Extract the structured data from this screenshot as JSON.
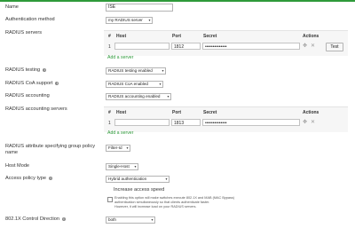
{
  "colors": {
    "accent": "#2e9a3a",
    "table_bg": "#f6f6f6"
  },
  "fields": {
    "name": {
      "label": "Name",
      "value": "ISE"
    },
    "auth_method": {
      "label": "Authentication method",
      "value": "my RADIUS server"
    },
    "radius_servers": {
      "label": "RADIUS servers",
      "headers": {
        "num": "#",
        "host": "Host",
        "port": "Port",
        "secret": "Secret",
        "actions": "Actions"
      },
      "rows": [
        {
          "num": "1",
          "host": "",
          "port": "1812",
          "secret": "••••••••••••••"
        }
      ],
      "test_label": "Test",
      "add_label": "Add a server"
    },
    "radius_testing": {
      "label": "RADIUS testing",
      "value": "RADIUS testing enabled"
    },
    "radius_coa": {
      "label": "RADIUS CoA support",
      "value": "RADIUS CoA enabled"
    },
    "radius_accounting": {
      "label": "RADIUS accounting",
      "value": "RADIUS accounting enabled"
    },
    "accounting_servers": {
      "label": "RADIUS accounting servers",
      "headers": {
        "num": "#",
        "host": "Host",
        "port": "Port",
        "secret": "Secret",
        "actions": "Actions"
      },
      "rows": [
        {
          "num": "1",
          "host": "",
          "port": "1813",
          "secret": "••••••••••••••"
        }
      ],
      "add_label": "Add a server"
    },
    "group_policy": {
      "label_line1": "RADIUS attribute specifying group policy",
      "label_line2": "name",
      "value": "Filter-Id"
    },
    "host_mode": {
      "label": "Host Mode",
      "value": "Single-Host"
    },
    "access_policy": {
      "label": "Access policy type",
      "value": "Hybrid authentication",
      "increase_speed_label": "Increase access speed",
      "note_line1": "Enabling this option will make switches execute 802.1X and MAB (MAC Bypass)",
      "note_line2": "authentication simultaneously so that clients authenticate faster.",
      "note_line3": "However, it will increase load on your RADIUS servers."
    },
    "control_direction": {
      "label": "802.1X Control Direction",
      "value": "both"
    }
  },
  "icons": {
    "info": "info-icon",
    "caret": "chevron-down-icon",
    "move": "move-icon",
    "delete": "close-icon"
  }
}
